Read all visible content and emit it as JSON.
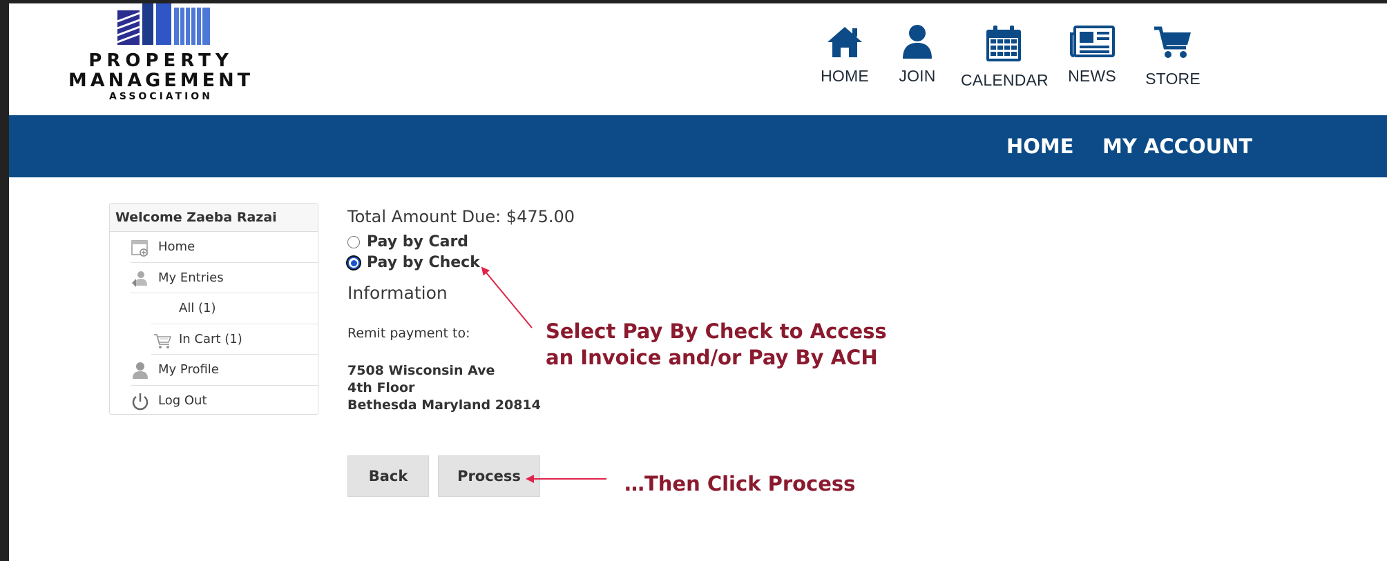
{
  "logo": {
    "line1": "PROPERTY",
    "line2": "MANAGEMENT",
    "line3": "ASSOCIATION"
  },
  "topnav": [
    {
      "icon": "home-icon",
      "label": "HOME"
    },
    {
      "icon": "user-icon",
      "label": "JOIN"
    },
    {
      "icon": "calendar-icon",
      "label": "CALENDAR"
    },
    {
      "icon": "newspaper-icon",
      "label": "NEWS"
    },
    {
      "icon": "cart-icon",
      "label": "STORE"
    }
  ],
  "bluebar": {
    "home": "HOME",
    "account": "MY ACCOUNT"
  },
  "sidebar": {
    "welcome": "Welcome Zaeba Razai",
    "items": [
      {
        "label": "Home"
      },
      {
        "label": "My Entries"
      },
      {
        "label": "All (1)"
      },
      {
        "label": "In Cart (1)"
      },
      {
        "label": "My Profile"
      },
      {
        "label": "Log Out"
      }
    ]
  },
  "main": {
    "total": "Total Amount Due: $475.00",
    "pay_card": "Pay by Card",
    "pay_check": "Pay by Check",
    "selected": "Pay by Check",
    "info_heading": "Information",
    "remit": "Remit payment to:",
    "address": [
      "7508 Wisconsin Ave",
      "4th Floor",
      "Bethesda Maryland 20814"
    ],
    "back": "Back",
    "process": "Process"
  },
  "annotations": {
    "note1_line1": "Select Pay By Check to Access",
    "note1_line2": "an Invoice and/or Pay By ACH",
    "note2": "…Then Click Process",
    "color": "#8b1a2e"
  },
  "colors": {
    "brand_blue": "#0c4b87",
    "radio_blue": "#1a55c8"
  }
}
